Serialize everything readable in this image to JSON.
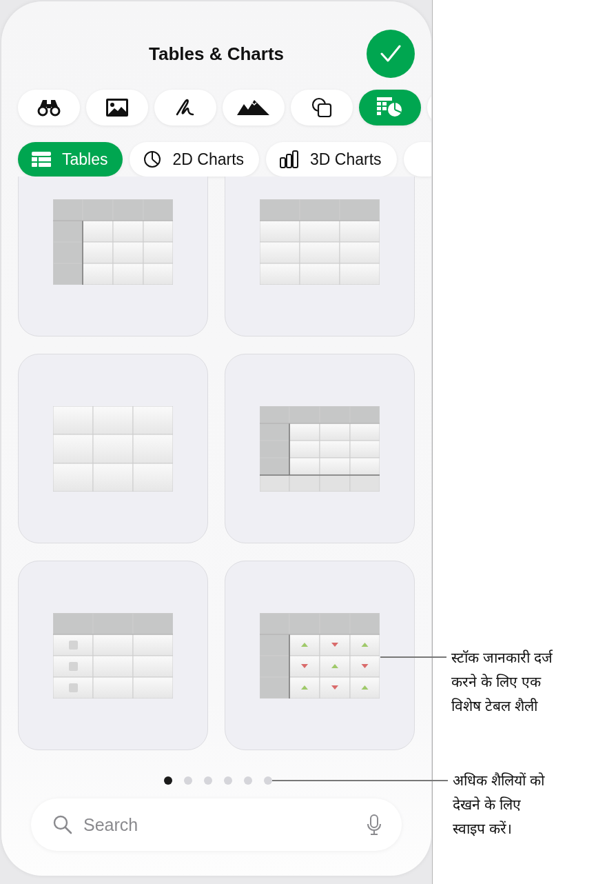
{
  "sheet": {
    "title": "Tables & Charts",
    "done_button": {
      "kind": "checkmark"
    },
    "insert_tabs": [
      {
        "kind": "binoculars",
        "selected": false
      },
      {
        "kind": "photo",
        "selected": false
      },
      {
        "kind": "squiggle",
        "selected": false
      },
      {
        "kind": "mountains",
        "selected": false
      },
      {
        "kind": "shapes",
        "selected": false
      },
      {
        "kind": "table-chart",
        "selected": true
      },
      {
        "kind": "cut-off",
        "selected": false
      }
    ],
    "category_tabs": [
      {
        "kind": "table",
        "label": "Tables",
        "selected": true
      },
      {
        "kind": "pie",
        "label": "2D Charts",
        "selected": false
      },
      {
        "kind": "bars3d",
        "label": "3D Charts",
        "selected": false
      },
      {
        "kind": "cut-off",
        "selected": false
      }
    ],
    "table_styles": [
      {
        "kind": "header-row-column"
      },
      {
        "kind": "header-row"
      },
      {
        "kind": "plain"
      },
      {
        "kind": "header-footer"
      },
      {
        "kind": "checkbox"
      },
      {
        "kind": "stock"
      }
    ],
    "page_dots": [
      {
        "selected": true
      },
      {
        "selected": false
      },
      {
        "selected": false
      },
      {
        "selected": false
      },
      {
        "selected": false
      },
      {
        "selected": false
      }
    ],
    "search": {
      "placeholder": "Search"
    }
  },
  "callouts": [
    {
      "text": "स्टॉक जानकारी दर्ज करने के लिए एक विशेष टेबल शैली"
    },
    {
      "text": "अधिक शैलियों को देखने के लिए स्वाइप करें।"
    }
  ]
}
